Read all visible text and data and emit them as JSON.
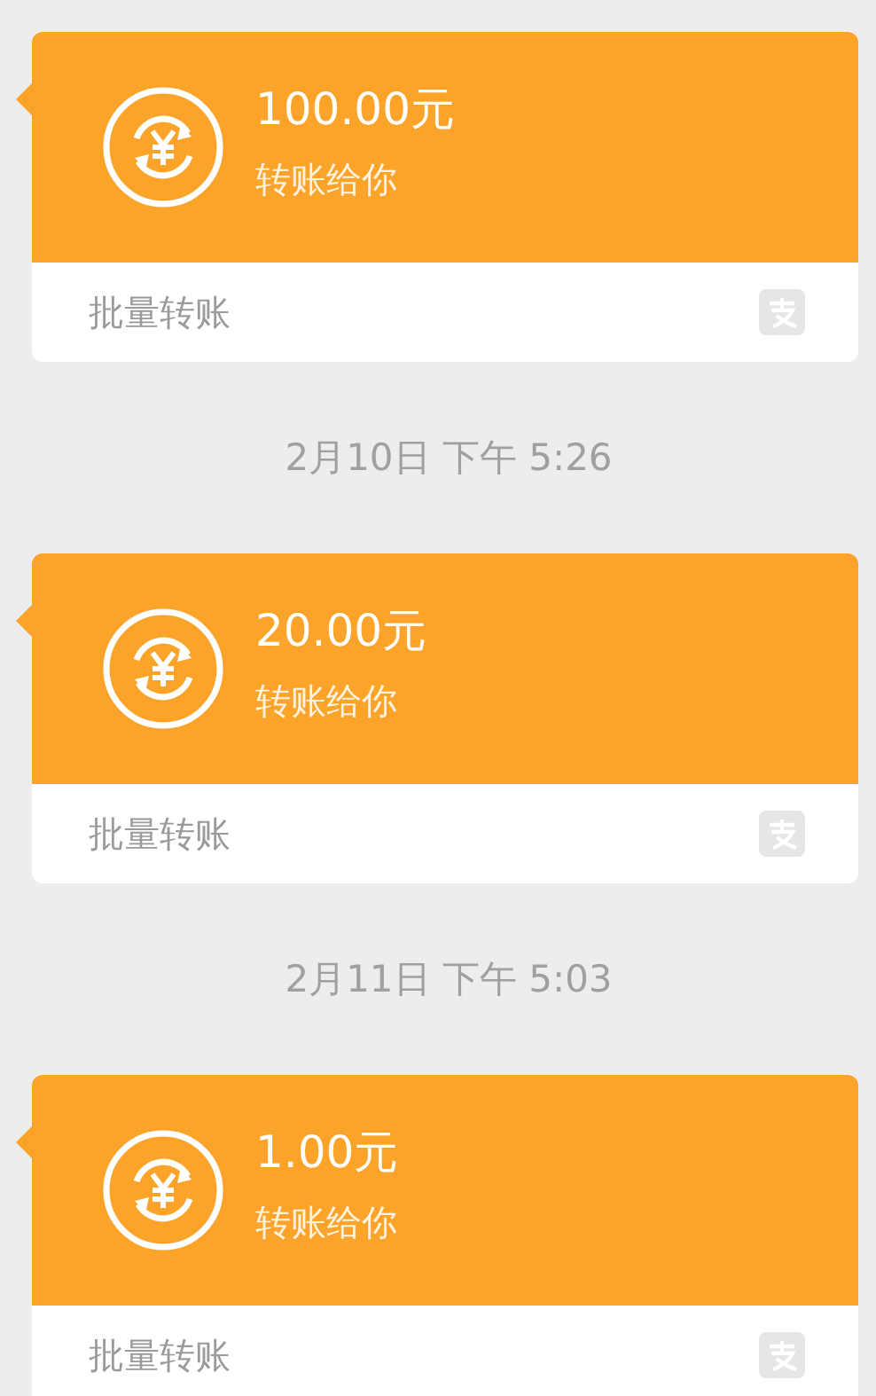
{
  "messages": [
    {
      "kind": "transfer",
      "amount": "100.00元",
      "caption": "转账给你",
      "footer": "批量转账"
    },
    {
      "kind": "timestamp",
      "text": "2月10日 下午 5:26"
    },
    {
      "kind": "transfer",
      "amount": "20.00元",
      "caption": "转账给你",
      "footer": "批量转账"
    },
    {
      "kind": "timestamp",
      "text": "2月11日 下午 5:03"
    },
    {
      "kind": "transfer",
      "amount": "1.00元",
      "caption": "转账给你",
      "footer": "批量转账"
    }
  ]
}
